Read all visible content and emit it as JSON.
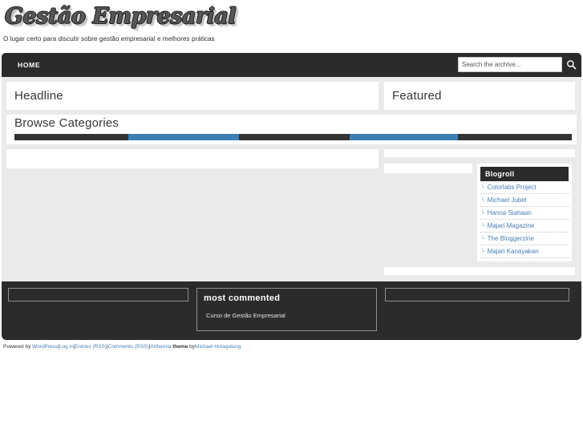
{
  "site": {
    "logo_text": "Gestão Empresarial",
    "tagline": "O lugar certo para discutir sobre gestão empresarial e melhores práticas"
  },
  "nav": {
    "items": [
      {
        "label": "HOME"
      }
    ],
    "search": {
      "placeholder": "Search the archive...",
      "value": "",
      "icon": "search-icon"
    }
  },
  "main": {
    "headline_title": "Headline",
    "featured_title": "Featured",
    "browse_title": "Browse Categories",
    "category_bar": {
      "segments": [
        {
          "color": "#333333",
          "width": 20.5
        },
        {
          "color": "#3b7fb5",
          "width": 19.8
        },
        {
          "color": "#333333",
          "width": 19.8
        },
        {
          "color": "#3b7fb5",
          "width": 19.5
        },
        {
          "color": "#333333",
          "width": 20.4
        }
      ]
    }
  },
  "sidebar": {
    "blogroll": {
      "title": "Blogroll",
      "tick": "└",
      "items": [
        {
          "label": "Colorlabs Project"
        },
        {
          "label": "Michael Jubel"
        },
        {
          "label": "Hanna Siahaan"
        },
        {
          "label": "Majari Magazine"
        },
        {
          "label": "The Bloggerzine"
        },
        {
          "label": "Majari Kanayakan"
        }
      ]
    }
  },
  "footer_widgets": {
    "most_commented": {
      "title": "most commented",
      "items": [
        {
          "label": "Curso de Gestão Empresarial"
        }
      ]
    }
  },
  "credits": {
    "powered_by": "Powered by",
    "wordpress": "WordPress",
    "login": "Log in",
    "entries_rss": "Entries (RSS)",
    "comments_rss": "Comments (RSS)",
    "theme_name": "Arthemia",
    "theme_word": "theme",
    "by": "by",
    "author": "Michael Hutagalung",
    "separator": "|"
  },
  "colors": {
    "dark": "#2b2b2b",
    "blue": "#3b7fb5",
    "link": "#4a7fb5",
    "page_bg": "#eaeaea"
  }
}
